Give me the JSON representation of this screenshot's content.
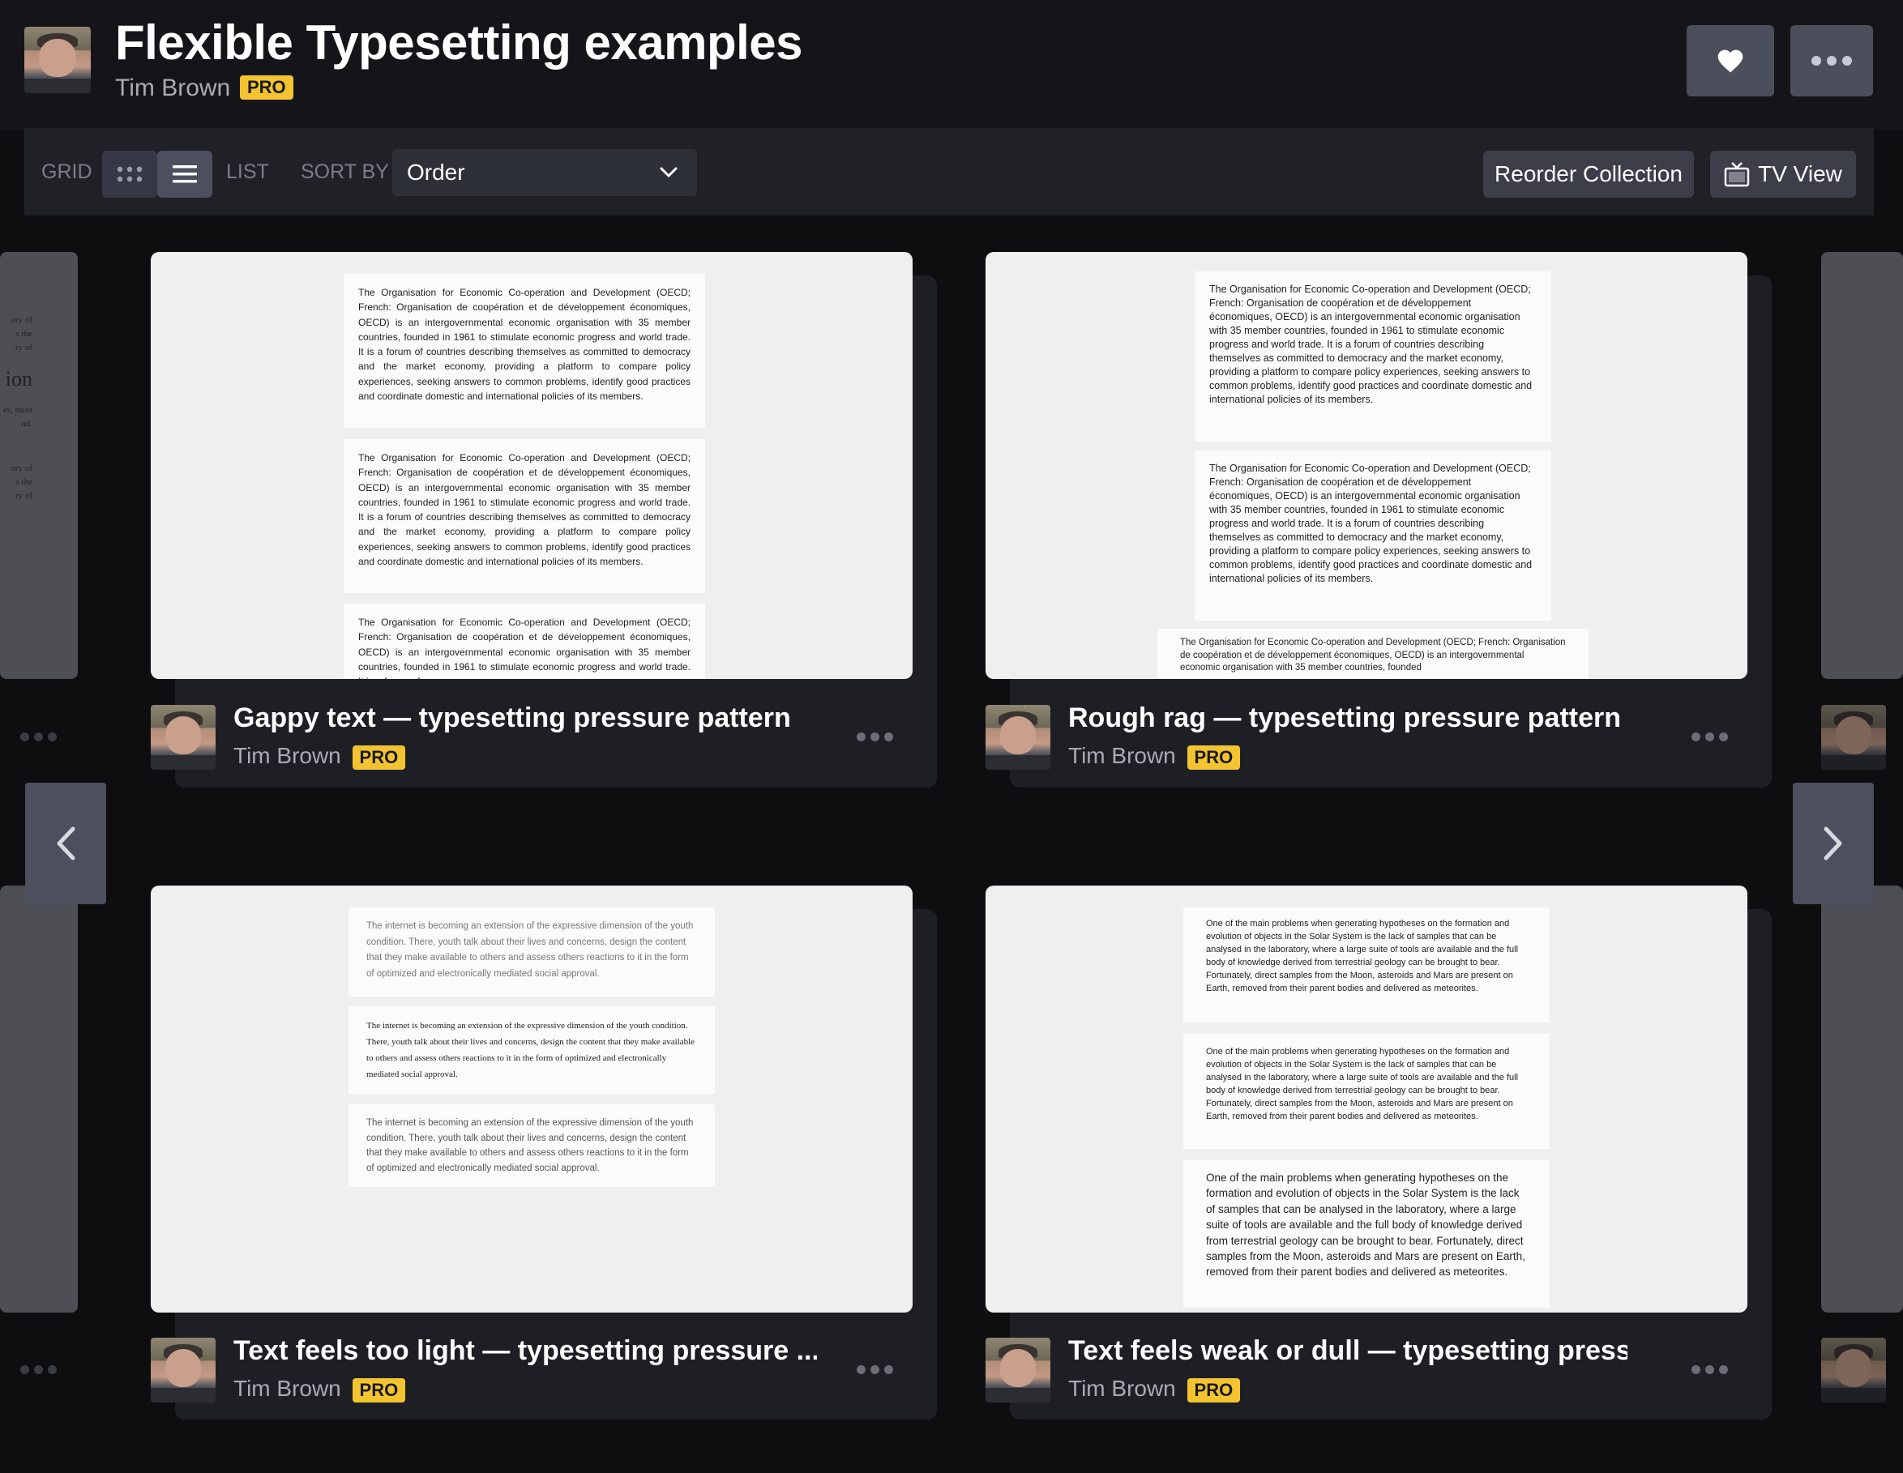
{
  "header": {
    "title": "Flexible Typesetting examples",
    "author": "Tim Brown",
    "badge": "PRO"
  },
  "toolbar": {
    "grid_label": "GRID",
    "list_label": "LIST",
    "sort_label": "SORT BY",
    "sort_value": "Order",
    "reorder_label": "Reorder Collection",
    "tv_label": "TV View"
  },
  "cards": [
    {
      "title": "Gappy text — typesetting pressure pattern",
      "author": "Tim Brown",
      "badge": "PRO",
      "paragraphs": [
        "The Organisation for Economic Co-operation and Development (OECD; French: Organisation de coopération et de développement économiques, OECD) is an intergovernmental economic organisation with 35 member countries, founded in 1961 to stimulate economic progress and world trade. It is a forum of countries describing themselves as committed to democracy and the market economy, providing a platform to compare policy experiences, seeking answers to common problems, identify good practices and coordinate domestic and international policies of its members.",
        "The Organisation for Economic Co-operation and Development (OECD; French: Organisation de coopération et de développement économiques, OECD) is an intergovernmental economic organisation with 35 member countries, founded in 1961 to stimulate economic progress and world trade. It is a forum of countries describing themselves as committed to democracy and the market economy, providing a platform to compare policy experiences, seeking answers to common problems, identify good practices and coordinate domestic and international policies of its members.",
        "The Organisation for Economic Co-operation and Development (OECD; French: Organisation de coopération et de développement économiques, OECD) is an intergovernmental economic organisation with 35 member countries, founded in 1961 to stimulate economic progress and world trade. It is a forum of"
      ]
    },
    {
      "title": "Rough rag — typesetting pressure pattern",
      "author": "Tim Brown",
      "badge": "PRO",
      "paragraphs": [
        "The Organisation for Economic Co-operation and Development (OECD; French: Organisation de coopération et de développement économiques, OECD) is an intergovernmental economic organisation with 35 member countries, founded in 1961 to stimulate economic progress and world trade. It is a forum of countries describing themselves as committed to democracy and the market economy, providing a platform to compare policy experiences, seeking answers to common problems, identify good practices and coordinate domestic and international policies of its members.",
        "The Organisation for Economic Co-operation and Development (OECD; French: Organisation de coopération et de développement économiques, OECD) is an intergovernmental economic organisation with 35 member countries, founded in 1961 to stimulate economic progress and world trade. It is a forum of countries describing themselves as committed to democracy and the market economy, providing a platform to compare policy experiences, seeking answers to common problems, identify good practices and coordinate domestic and international policies of its members.",
        "The Organisation for Economic Co-operation and Development (OECD; French: Organisation de coopération et de développement économiques, OECD) is an intergovernmental economic organisation with 35 member countries, founded"
      ]
    },
    {
      "title": "Text feels too light — typesetting pressure ...",
      "author": "Tim Brown",
      "badge": "PRO",
      "paragraphs": [
        "The internet is becoming an extension of the expressive dimension of the youth condition. There, youth talk about their lives and concerns, design the content that they make available to others and assess others reactions to it in the form of optimized and electronically mediated social approval.",
        "The internet is becoming an extension of the expressive dimension of the youth condition. There, youth talk about their lives and concerns, design the content that they make available to others and assess others reactions to it in the form of optimized and electronically mediated social approval.",
        "The internet is becoming an extension of the expressive dimension of the youth condition. There, youth talk about their lives and concerns, design the content that they make available to others and assess others reactions to it in the form of optimized and electronically mediated social approval."
      ]
    },
    {
      "title": "Text feels weak or dull — typesetting press...",
      "author": "Tim Brown",
      "badge": "PRO",
      "paragraphs": [
        "One of the main problems when generating hypotheses on the formation and evolution of objects in the Solar System is the lack of samples that can be analysed in the laboratory, where a large suite of tools are available and the full body of knowledge derived from terrestrial geology can be brought to bear. Fortunately, direct samples from the Moon, asteroids and Mars are present on Earth, removed from their parent bodies and delivered as meteorites.",
        "One of the main problems when generating hypotheses on the formation and evolution of objects in the Solar System is the lack of samples that can be analysed in the laboratory, where a large suite of tools are available and the full body of knowledge derived from terrestrial geology can be brought to bear. Fortunately, direct samples from the Moon, asteroids and Mars are present on Earth, removed from their parent bodies and delivered as meteorites.",
        "One of the main problems when generating hypotheses on the formation and evolution of objects in the Solar System is the lack of samples that can be analysed in the laboratory, where a large suite of tools are available and the full body of knowledge derived from terrestrial geology can be brought to bear. Fortunately, direct samples from the Moon, asteroids and Mars are present on Earth, removed from their parent bodies and delivered as meteorites."
      ]
    }
  ],
  "left_peek": {
    "fragments": [
      "ory of",
      "s the",
      "ry of",
      "ion",
      "es, most",
      "nd.",
      "ory of",
      "s the",
      "ry of"
    ]
  },
  "icons": {
    "heart": "heart-icon",
    "more": "more-icon",
    "grid": "grid-icon",
    "list": "list-icon",
    "chevron": "chevron-down-icon",
    "tv": "tv-icon",
    "prev": "chevron-left-icon",
    "next": "chevron-right-icon"
  },
  "colors": {
    "background": "#0e0e11",
    "header": "#151519",
    "toolbar": "#202127",
    "pro_badge": "#f4c430",
    "button": "#3c3f4a"
  }
}
